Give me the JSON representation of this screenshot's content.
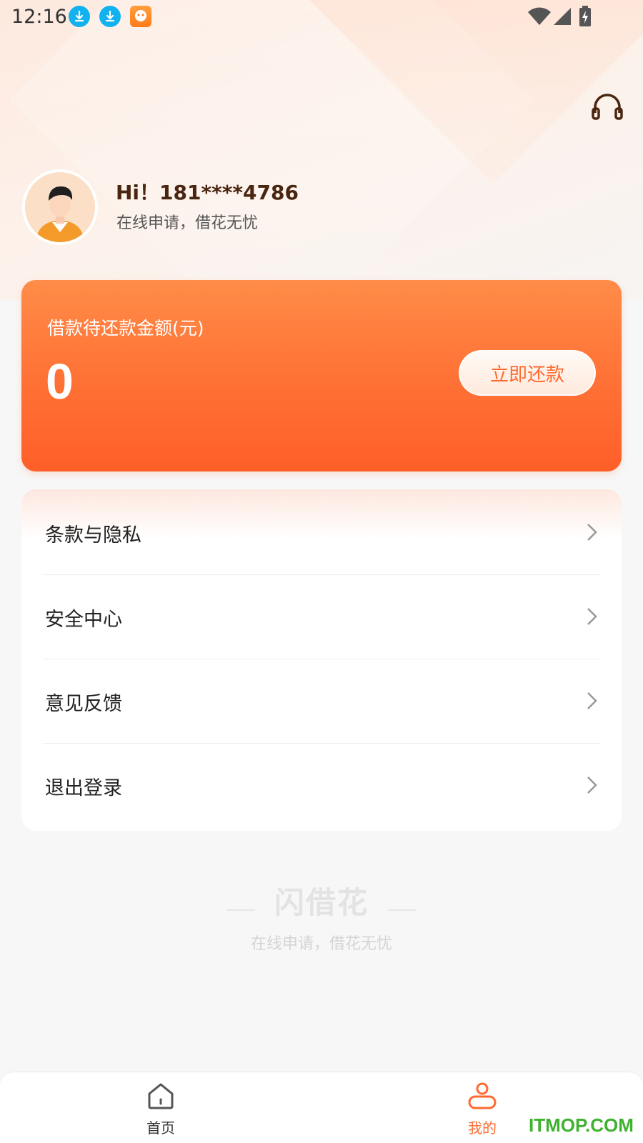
{
  "status_bar": {
    "time": "12:16"
  },
  "profile": {
    "greeting": "Hi！181****4786",
    "slogan": "在线申请，借花无忧"
  },
  "loan_card": {
    "label": "借款待还款金额(元)",
    "amount": "0",
    "repay_button": "立即还款"
  },
  "menu": {
    "items": [
      {
        "label": "条款与隐私"
      },
      {
        "label": "安全中心"
      },
      {
        "label": "意见反馈"
      },
      {
        "label": "退出登录"
      }
    ]
  },
  "footer": {
    "brand": "闪借花",
    "slogan": "在线申请，借花无忧"
  },
  "bottom_nav": {
    "items": [
      {
        "label": "首页",
        "active": false
      },
      {
        "label": "我的",
        "active": true
      }
    ]
  },
  "watermark": "ITMOP.COM",
  "colors": {
    "accent": "#ff6a30",
    "card_gradient_top": "#ff8c48",
    "card_gradient_bottom": "#ff5f28",
    "nav_inactive": "#555555"
  },
  "icons": [
    "download-icon",
    "app-notification-icon",
    "wifi-icon",
    "signal-icon",
    "battery-icon",
    "headset-icon",
    "chevron-right-icon",
    "home-icon",
    "profile-icon"
  ]
}
